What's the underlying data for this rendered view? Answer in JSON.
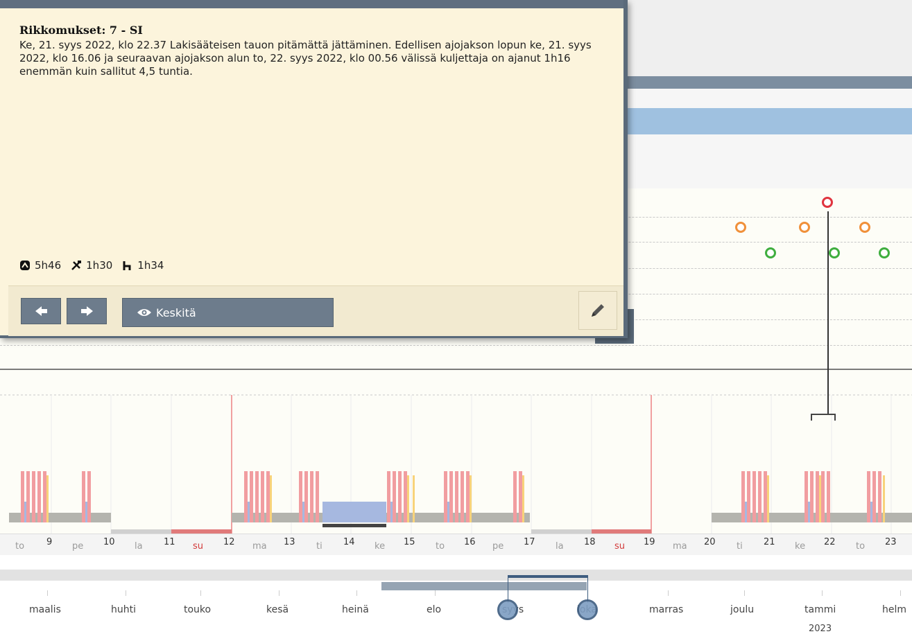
{
  "popup": {
    "title": "Rikkomukset: 7 - SI",
    "description": "Ke, 21. syys 2022, klo 22.37 Lakisääteisen tauon pitämättä jättäminen. Edellisen ajojakson lopun ke, 21. syys 2022, klo 16.06 ja seuraavan ajojakson alun to, 22. syys 2022, klo 00.56 välissä kuljettaja on ajanut 1h16 enemmän kuin sallitut 4,5 tuntia.",
    "stats": {
      "drive": {
        "icon": "steering-wheel-icon",
        "value": "5h46"
      },
      "work": {
        "icon": "hammer-icon",
        "value": "1h30"
      },
      "rest": {
        "icon": "bed-icon",
        "value": "1h34"
      }
    },
    "prev_icon": "arrow-left-icon",
    "next_icon": "arrow-right-icon",
    "center_label": "Keskitä",
    "center_icon": "eye-icon",
    "edit_icon": "pencil-icon"
  },
  "colors": {
    "accent": "#6d7c8c",
    "violation_red": "#e0343f",
    "warning_orange": "#f0903a",
    "ok_green": "#3fae3f",
    "drive_bar": "#f19da0",
    "rest_bar": "#a6b8e0"
  },
  "timeline": {
    "days": [
      {
        "weekday": "to",
        "date": "9"
      },
      {
        "weekday": "pe",
        "date": "10"
      },
      {
        "weekday": "la",
        "date": "11"
      },
      {
        "weekday": "su",
        "date": "12"
      },
      {
        "weekday": "ma",
        "date": "13"
      },
      {
        "weekday": "ti",
        "date": "14"
      },
      {
        "weekday": "ke",
        "date": "15"
      },
      {
        "weekday": "to",
        "date": "16"
      },
      {
        "weekday": "pe",
        "date": "17"
      },
      {
        "weekday": "la",
        "date": "18"
      },
      {
        "weekday": "su",
        "date": "19"
      },
      {
        "weekday": "ma",
        "date": "20"
      },
      {
        "weekday": "ti",
        "date": "21"
      },
      {
        "weekday": "ke",
        "date": "22"
      },
      {
        "weekday": "to",
        "date": "23"
      }
    ]
  },
  "months": {
    "labels": [
      "maalis",
      "huhti",
      "touko",
      "kesä",
      "heinä",
      "elo",
      "syys",
      "loka",
      "marras",
      "joulu",
      "tammi",
      "helm"
    ],
    "year_label": "2023"
  }
}
